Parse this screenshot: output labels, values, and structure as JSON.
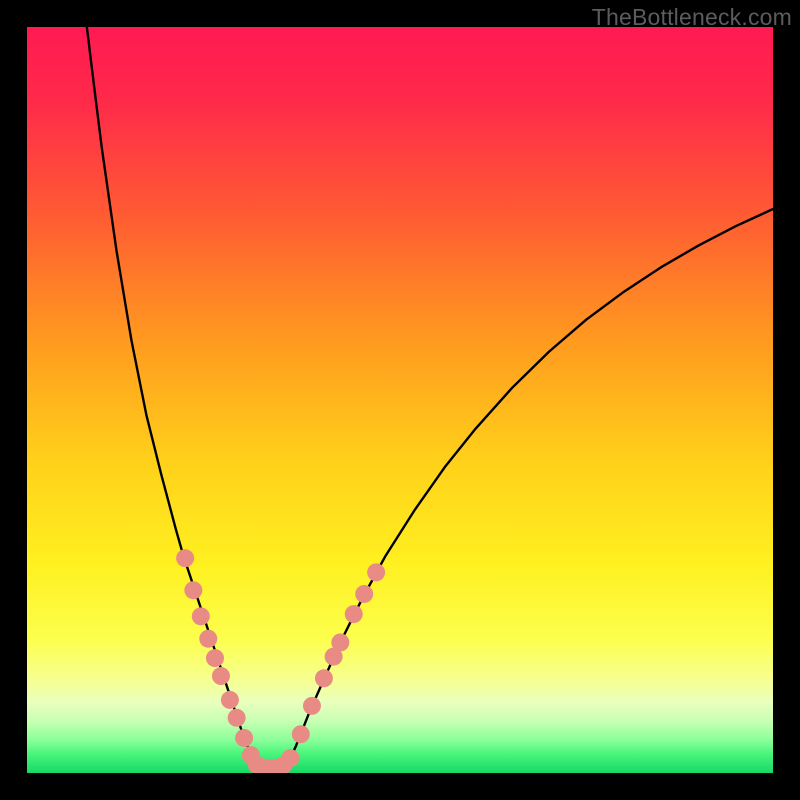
{
  "watermark": "TheBottleneck.com",
  "colors": {
    "frame": "#000000",
    "gradient_stops": [
      {
        "offset": 0.0,
        "color": "#ff1a52"
      },
      {
        "offset": 0.1,
        "color": "#ff2a4a"
      },
      {
        "offset": 0.25,
        "color": "#ff5a33"
      },
      {
        "offset": 0.42,
        "color": "#ff9a1f"
      },
      {
        "offset": 0.58,
        "color": "#ffd01a"
      },
      {
        "offset": 0.72,
        "color": "#fff020"
      },
      {
        "offset": 0.82,
        "color": "#fcff4d"
      },
      {
        "offset": 0.875,
        "color": "#f6ff90"
      },
      {
        "offset": 0.905,
        "color": "#e9ffbd"
      },
      {
        "offset": 0.93,
        "color": "#c8ffb3"
      },
      {
        "offset": 0.955,
        "color": "#8dff9a"
      },
      {
        "offset": 0.975,
        "color": "#46f57a"
      },
      {
        "offset": 1.0,
        "color": "#18d867"
      }
    ],
    "curve": "#000000",
    "marker_fill": "#e98b85",
    "marker_stroke": "#d07a73"
  },
  "chart_data": {
    "type": "line",
    "title": "",
    "xlabel": "",
    "ylabel": "",
    "xlim": [
      0,
      100
    ],
    "ylim": [
      0,
      100
    ],
    "series": [
      {
        "name": "left-curve",
        "x": [
          7.9,
          9,
          10,
          12,
          14,
          16,
          18,
          20,
          21,
          22,
          23,
          24,
          25,
          26,
          27,
          28,
          29,
          30,
          30.5
        ],
        "y": [
          101,
          92,
          84,
          70,
          58,
          48,
          40,
          32.5,
          29,
          26,
          23,
          20,
          17,
          14,
          11,
          8,
          5,
          2.5,
          1.2
        ]
      },
      {
        "name": "floor",
        "x": [
          30.5,
          31,
          32,
          33,
          34,
          35
        ],
        "y": [
          1.2,
          0.8,
          0.6,
          0.6,
          0.8,
          1.4
        ]
      },
      {
        "name": "right-curve",
        "x": [
          35,
          36,
          38,
          40,
          42,
          45,
          48,
          52,
          56,
          60,
          65,
          70,
          75,
          80,
          85,
          90,
          95,
          100
        ],
        "y": [
          1.4,
          3.5,
          8.5,
          13,
          17.5,
          23.5,
          29,
          35.3,
          41,
          46,
          51.6,
          56.5,
          60.8,
          64.5,
          67.8,
          70.7,
          73.3,
          75.6
        ]
      }
    ],
    "markers": [
      {
        "x": 21.2,
        "y": 28.8
      },
      {
        "x": 22.3,
        "y": 24.5
      },
      {
        "x": 23.3,
        "y": 21.0
      },
      {
        "x": 24.3,
        "y": 18.0
      },
      {
        "x": 25.2,
        "y": 15.4
      },
      {
        "x": 26.0,
        "y": 13.0
      },
      {
        "x": 27.2,
        "y": 9.8
      },
      {
        "x": 28.1,
        "y": 7.4
      },
      {
        "x": 29.1,
        "y": 4.7
      },
      {
        "x": 30.0,
        "y": 2.4
      },
      {
        "x": 30.8,
        "y": 1.1
      },
      {
        "x": 32.0,
        "y": 0.7
      },
      {
        "x": 33.2,
        "y": 0.7
      },
      {
        "x": 34.3,
        "y": 1.0
      },
      {
        "x": 35.3,
        "y": 2.0
      },
      {
        "x": 36.7,
        "y": 5.2
      },
      {
        "x": 38.2,
        "y": 9.0
      },
      {
        "x": 39.8,
        "y": 12.7
      },
      {
        "x": 41.1,
        "y": 15.6
      },
      {
        "x": 42.0,
        "y": 17.5
      },
      {
        "x": 43.8,
        "y": 21.3
      },
      {
        "x": 45.2,
        "y": 24.0
      },
      {
        "x": 46.8,
        "y": 26.9
      }
    ],
    "marker_radius_px": 9
  }
}
